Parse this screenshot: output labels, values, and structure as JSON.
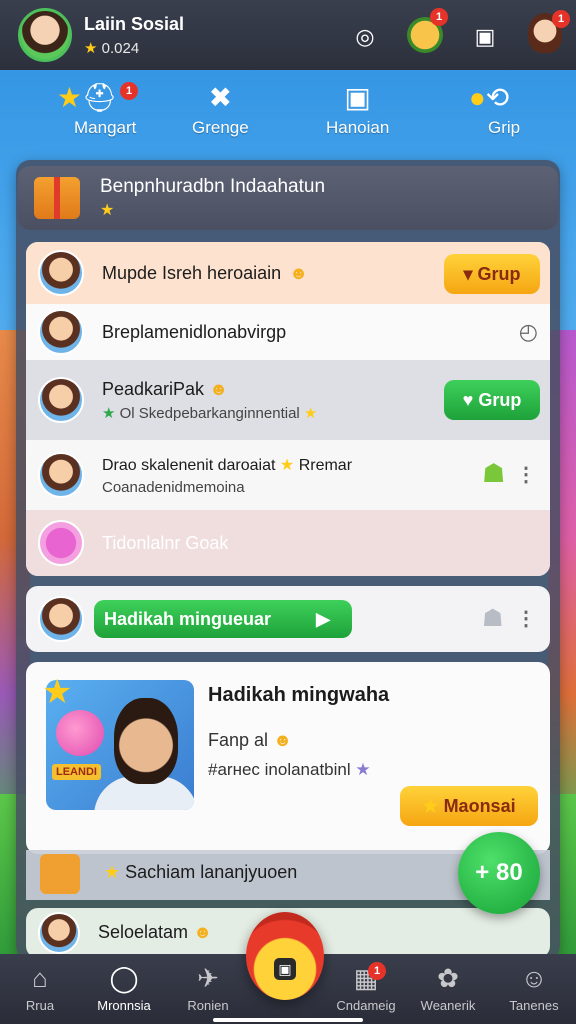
{
  "header": {
    "user_name": "Laiin Sosial",
    "score": "0.024",
    "badges": {
      "notif_coin": "1",
      "notif_kid": "1"
    }
  },
  "categories": [
    {
      "label": "Mangart",
      "icon": "bear-hat-icon",
      "badge": "1"
    },
    {
      "label": "Grenge",
      "icon": "tools-icon"
    },
    {
      "label": "Hanoian",
      "icon": "frame-icon"
    },
    {
      "label": "Grip",
      "icon": "grip-icon"
    }
  ],
  "panel_header": {
    "title": "Benpnhuradbn Indaahatun",
    "star": "★"
  },
  "rows": [
    {
      "title": "Mupde Isrеh heroaiain",
      "button": "Grup"
    },
    {
      "title": "Breplamenidlonabvirgp"
    },
    {
      "title": "PeadkariPak",
      "subtitle": "Ol   Skedpebarkanginnential",
      "button": "Grup"
    },
    {
      "title": "Drao skalenenit daroaiat",
      "title_extra": "Rremar",
      "subtitle": "Coanadenidmemoina"
    },
    {
      "title": "Tidonlalnr Goak"
    }
  ],
  "card_mid": {
    "button": "Hadikah mingueuar"
  },
  "card_feature": {
    "title": "Hadikah mingwaha",
    "line1": "Fanp al",
    "line2": "#arнec inolanatbinl",
    "button": "Maonsai",
    "photo_tag": "LEANDI"
  },
  "card_footer": {
    "text": "Sachiam lananjyuoen"
  },
  "card_bottom": {
    "text": "Seloelatam"
  },
  "fab": {
    "label": "+ 80"
  },
  "bottom_nav": [
    {
      "label": "Rrua",
      "icon": "home-icon"
    },
    {
      "label": "Mronnsia",
      "icon": "chat-icon"
    },
    {
      "label": "Ronien",
      "icon": "bird-icon"
    },
    {
      "label": "Cndameig",
      "icon": "shop-icon",
      "badge": "1"
    },
    {
      "label": "Weanerik",
      "icon": "paw-icon"
    },
    {
      "label": "Tanenes",
      "icon": "profile-icon"
    }
  ],
  "colors": {
    "accent_green": "#1ea23a",
    "accent_orange": "#f5a612",
    "badge_red": "#e6332a"
  }
}
